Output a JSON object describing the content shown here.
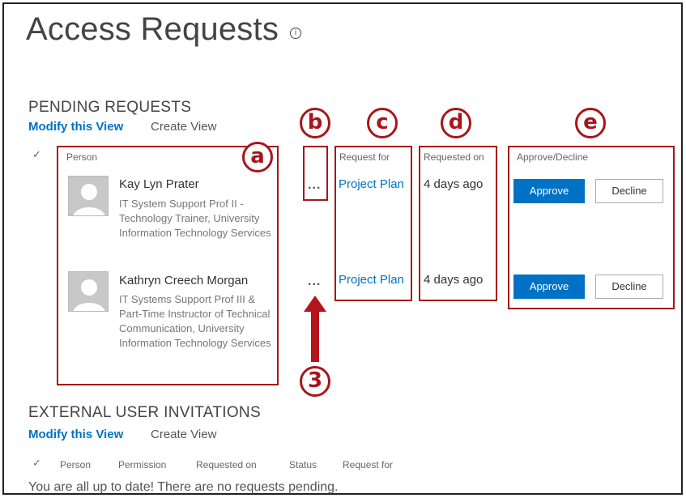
{
  "page": {
    "title": "Access Requests",
    "info_icon": "info-circle-icon"
  },
  "pending": {
    "heading": "PENDING REQUESTS",
    "modify_view": "Modify this View",
    "create_view": "Create View",
    "check_glyph": "✓",
    "columns": {
      "person": "Person",
      "request_for": "Request for",
      "requested_on": "Requested on",
      "approve_decline": "Approve/Decline"
    },
    "rows": [
      {
        "name": "Kay Lyn Prater",
        "title": "IT System Support Prof II - Technology Trainer, University Information Technology Services",
        "more": "...",
        "request_for": "Project Plan",
        "requested_on": "4 days ago",
        "approve": "Approve",
        "decline": "Decline"
      },
      {
        "name": "Kathryn Creech Morgan",
        "title": "IT Systems Support Prof III & Part-Time Instructor of Technical Communication, University Information Technology Services",
        "more": "...",
        "request_for": "Project Plan",
        "requested_on": "4 days ago",
        "approve": "Approve",
        "decline": "Decline"
      }
    ]
  },
  "external": {
    "heading": "EXTERNAL USER INVITATIONS",
    "modify_view": "Modify this View",
    "create_view": "Create View",
    "check_glyph": "✓",
    "columns": {
      "person": "Person",
      "permission": "Permission",
      "requested_on": "Requested on",
      "status": "Status",
      "request_for": "Request for"
    },
    "empty_message": "You are all up to date! There are no requests pending."
  },
  "annotations": {
    "callouts": [
      "a",
      "b",
      "c",
      "d",
      "e",
      "3"
    ],
    "color": "#a8151b"
  },
  "colors": {
    "accent": "#0072c6",
    "annotation": "#a8151b"
  }
}
